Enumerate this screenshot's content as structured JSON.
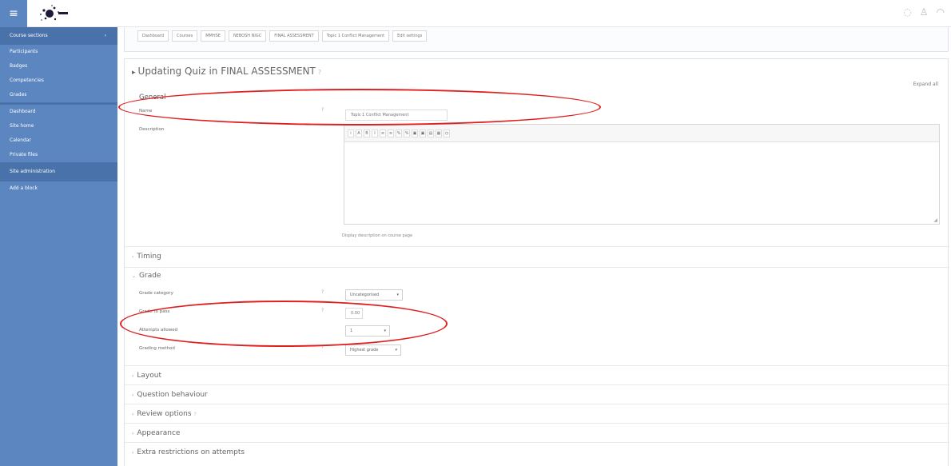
{
  "topbar": {
    "menu_icon": "hamburger-icon",
    "logo_icon": "splash-logo-icon",
    "icons": [
      "chat-icon",
      "user-icon",
      "headset-icon"
    ]
  },
  "sidebar": {
    "items": [
      {
        "label": "Course sections",
        "chevron": "›"
      },
      {
        "label": "Participants"
      },
      {
        "label": "Badges"
      },
      {
        "label": "Competencies"
      },
      {
        "label": "Grades"
      },
      {
        "label": "Dashboard"
      },
      {
        "label": "Site home"
      },
      {
        "label": "Calendar"
      },
      {
        "label": "Private files"
      },
      {
        "label": "Site administration"
      },
      {
        "label": "Add a block"
      }
    ]
  },
  "breadcrumb": {
    "tabs": [
      "Dashboard",
      "Courses",
      "MMHSE",
      "NEBOSH NIGC",
      "FINAL ASSESSMENT",
      "Topic 1 Conflict Management",
      "Edit settings"
    ]
  },
  "form": {
    "title_arrow": "▸",
    "title": "Updating Quiz in FINAL ASSESSMENT",
    "title_help": "?",
    "expand_all": "Expand all",
    "general_legend": "General",
    "name_label": "Name",
    "name_value": "Topic 1 Conflict Management",
    "description_label": "Description",
    "toolbar_buttons": [
      "i",
      "A",
      "B",
      "I",
      "≡",
      "≡",
      "%",
      "%",
      "▣",
      "▣",
      "▤",
      "▦",
      "◷"
    ],
    "display_description": "Display description on course page",
    "sections": {
      "timing": "Timing",
      "grade": "Grade",
      "layout": "Layout",
      "question_behaviour": "Question behaviour",
      "review_options": "Review options",
      "appearance": "Appearance",
      "extra_restrictions": "Extra restrictions on attempts"
    },
    "grade_category_label": "Grade category",
    "grade_category_value": "Uncategorised",
    "grade_to_pass_label": "Grade to pass",
    "grade_to_pass_value": "0.00",
    "attempts_label": "Attempts allowed",
    "attempts_value": "1",
    "grading_method_label": "Grading method",
    "grading_method_value": "Highest grade",
    "help_mark": "?",
    "caret_closed": "›",
    "caret_open": "⌄",
    "select_caret": "▾"
  }
}
